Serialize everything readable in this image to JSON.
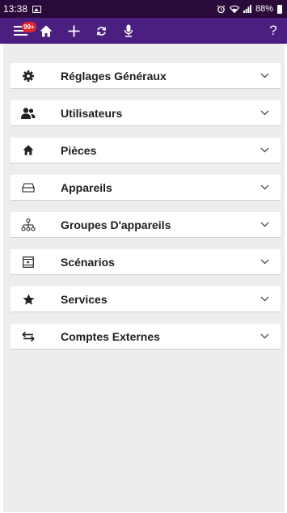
{
  "status_bar": {
    "time": "13:38",
    "battery": "88%",
    "icons": [
      "image-notification-icon",
      "alarm-icon",
      "wifi-icon",
      "signal-icon",
      "battery-icon"
    ]
  },
  "toolbar": {
    "notification_badge": "99+",
    "help_label": "?",
    "icons": [
      "menu-icon",
      "home-icon",
      "add-icon",
      "refresh-icon",
      "microphone-icon"
    ],
    "background": "#4a1f80"
  },
  "menu": {
    "items": [
      {
        "label": "Réglages Généraux",
        "icon": "gear-icon"
      },
      {
        "label": "Utilisateurs",
        "icon": "users-icon"
      },
      {
        "label": "Pièces",
        "icon": "home-icon"
      },
      {
        "label": "Appareils",
        "icon": "device-icon"
      },
      {
        "label": "Groupes D'appareils",
        "icon": "device-group-icon"
      },
      {
        "label": "Scénarios",
        "icon": "scenario-icon"
      },
      {
        "label": "Services",
        "icon": "star-icon"
      },
      {
        "label": "Comptes Externes",
        "icon": "external-accounts-icon"
      }
    ]
  },
  "colors": {
    "status_bar": "#2a0a3a",
    "badge": "#e4262b",
    "list_background": "#ededed"
  }
}
